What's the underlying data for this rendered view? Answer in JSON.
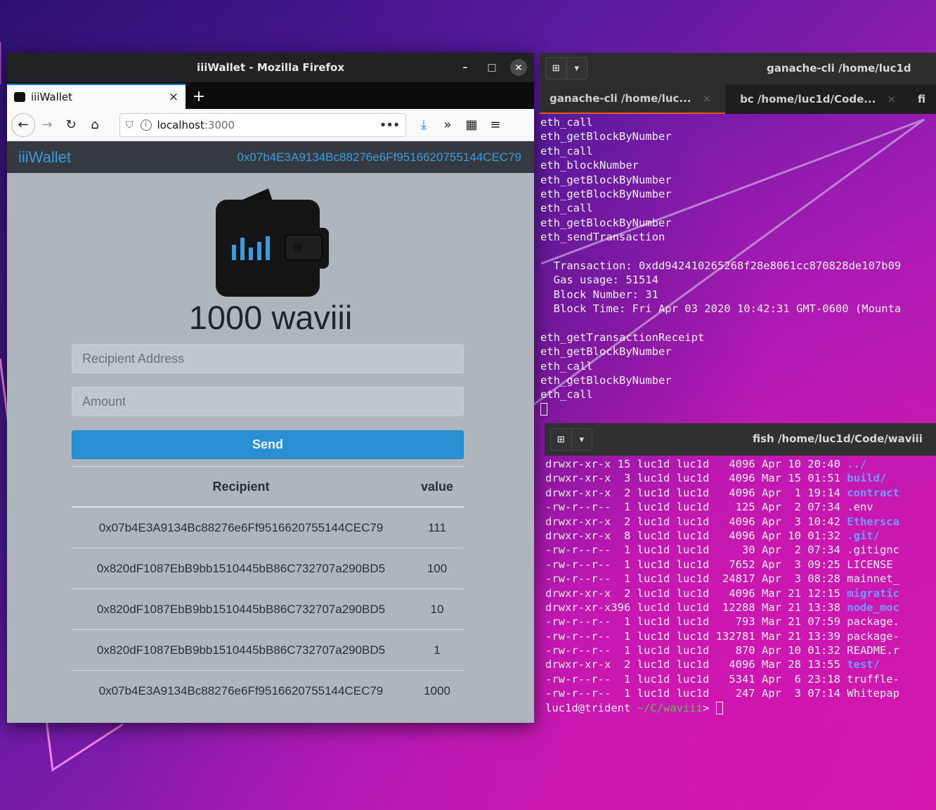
{
  "firefox": {
    "window_title": "iiiWallet - Mozilla Firefox",
    "tab_title": "iiiWallet",
    "tab_close": "×",
    "new_tab": "+",
    "url_host": "localhost",
    "url_port": ":3000",
    "url_more": "•••",
    "minimize": "–",
    "maximize": "□",
    "close": "×"
  },
  "wallet": {
    "brand": "iiiWallet",
    "account": "0x07b4E3A9134Bc88276e6Ff9516620755144CEC79",
    "balance": "1000 waviii",
    "recipient_placeholder": "Recipient Address",
    "amount_placeholder": "Amount",
    "send_label": "Send",
    "table_headers": {
      "recipient": "Recipient",
      "value": "value"
    },
    "transactions": [
      {
        "recipient": "0x07b4E3A9134Bc88276e6Ff9516620755144CEC79",
        "value": "111"
      },
      {
        "recipient": "0x820dF1087EbB9bb1510445bB86C732707a290BD5",
        "value": "100"
      },
      {
        "recipient": "0x820dF1087EbB9bb1510445bB86C732707a290BD5",
        "value": "10"
      },
      {
        "recipient": "0x820dF1087EbB9bb1510445bB86C732707a290BD5",
        "value": "1"
      },
      {
        "recipient": "0x07b4E3A9134Bc88276e6Ff9516620755144CEC79",
        "value": "1000"
      }
    ],
    "accent_color": "#2b8fd4"
  },
  "ganache_terminal": {
    "title": "ganache-cli /home/luc1d",
    "tabs": [
      "ganache-cli /home/luc...",
      "bc /home/luc1d/Code...",
      "fi"
    ],
    "lines": [
      "eth_call",
      "eth_getBlockByNumber",
      "eth_call",
      "eth_blockNumber",
      "eth_getBlockByNumber",
      "eth_getBlockByNumber",
      "eth_call",
      "eth_getBlockByNumber",
      "eth_sendTransaction",
      "",
      "  Transaction: 0xdd942410265268f28e8061cc870828de107b09",
      "  Gas usage: 51514",
      "  Block Number: 31",
      "  Block Time: Fri Apr 03 2020 10:42:31 GMT-0600 (Mounta",
      "",
      "eth_getTransactionReceipt",
      "eth_getBlockByNumber",
      "eth_call",
      "eth_getBlockByNumber",
      "eth_call"
    ]
  },
  "fish_terminal": {
    "title": "fish /home/luc1d/Code/waviii",
    "listing": [
      {
        "perm": "drwxr-xr-x",
        "meta": " 15 luc1d luc1d   4096 Apr 10 20:40 ",
        "name": "../",
        "dir": true
      },
      {
        "perm": "drwxr-xr-x",
        "meta": "  3 luc1d luc1d   4096 Mar 15 01:51 ",
        "name": "build/",
        "dir": true
      },
      {
        "perm": "drwxr-xr-x",
        "meta": "  2 luc1d luc1d   4096 Apr  1 19:14 ",
        "name": "contract",
        "dir": true
      },
      {
        "perm": "-rw-r--r--",
        "meta": "  1 luc1d luc1d    125 Apr  2 07:34 ",
        "name": ".env",
        "dir": false
      },
      {
        "perm": "drwxr-xr-x",
        "meta": "  2 luc1d luc1d   4096 Apr  3 10:42 ",
        "name": "Ethersca",
        "dir": true
      },
      {
        "perm": "drwxr-xr-x",
        "meta": "  8 luc1d luc1d   4096 Apr 10 01:32 ",
        "name": ".git/",
        "dir": true
      },
      {
        "perm": "-rw-r--r--",
        "meta": "  1 luc1d luc1d     30 Apr  2 07:34 ",
        "name": ".gitignc",
        "dir": false
      },
      {
        "perm": "-rw-r--r--",
        "meta": "  1 luc1d luc1d   7652 Apr  3 09:25 ",
        "name": "LICENSE",
        "dir": false
      },
      {
        "perm": "-rw-r--r--",
        "meta": "  1 luc1d luc1d  24817 Apr  3 08:28 ",
        "name": "mainnet_",
        "dir": false
      },
      {
        "perm": "drwxr-xr-x",
        "meta": "  2 luc1d luc1d   4096 Mar 21 12:15 ",
        "name": "migratic",
        "dir": true
      },
      {
        "perm": "drwxr-xr-x",
        "meta": "396 luc1d luc1d  12288 Mar 21 13:38 ",
        "name": "node_moc",
        "dir": true
      },
      {
        "perm": "-rw-r--r--",
        "meta": "  1 luc1d luc1d    793 Mar 21 07:59 ",
        "name": "package.",
        "dir": false
      },
      {
        "perm": "-rw-r--r--",
        "meta": "  1 luc1d luc1d 132781 Mar 21 13:39 ",
        "name": "package-",
        "dir": false
      },
      {
        "perm": "-rw-r--r--",
        "meta": "  1 luc1d luc1d    870 Apr 10 01:32 ",
        "name": "README.r",
        "dir": false
      },
      {
        "perm": "drwxr-xr-x",
        "meta": "  2 luc1d luc1d   4096 Mar 28 13:55 ",
        "name": "test/",
        "dir": true
      },
      {
        "perm": "-rw-r--r--",
        "meta": "  1 luc1d luc1d   5341 Apr  6 23:18 ",
        "name": "truffle-",
        "dir": false
      },
      {
        "perm": "-rw-r--r--",
        "meta": "  1 luc1d luc1d    247 Apr  3 07:14 ",
        "name": "Whitepap",
        "dir": false
      }
    ],
    "prompt_user": "luc1d@trident",
    "prompt_path": "~/C/waviii",
    "prompt_symbol": ">"
  }
}
